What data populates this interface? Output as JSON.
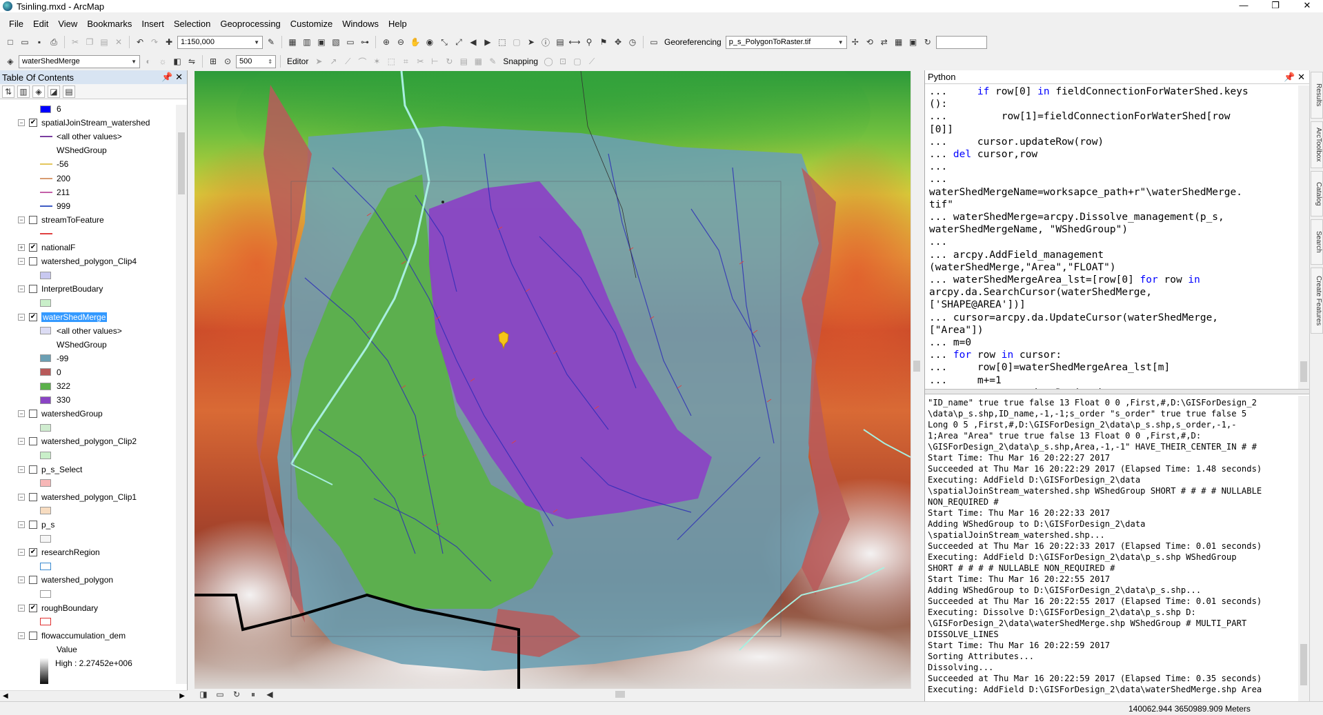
{
  "window": {
    "title": "Tsinling.mxd - ArcMap",
    "min_glyph": "—",
    "max_glyph": "❐",
    "close_glyph": "✕"
  },
  "menu": [
    "File",
    "Edit",
    "View",
    "Bookmarks",
    "Insert",
    "Selection",
    "Geoprocessing",
    "Customize",
    "Windows",
    "Help"
  ],
  "toolbar": {
    "scale": "1:150,000",
    "georeferencing_label": "Georeferencing",
    "georef_layer": "p_s_PolygonToRaster.tif",
    "find_input": "",
    "layer_combo": "waterShedMerge",
    "tolerance": "500",
    "editor_label": "Editor",
    "snapping_label": "Snapping"
  },
  "toc": {
    "title": "Table Of Contents",
    "rows": [
      {
        "kind": "class",
        "label": "6",
        "color": "#0000ff"
      },
      {
        "kind": "layer",
        "label": "spatialJoinStream_watershed",
        "checked": true,
        "expanded": true
      },
      {
        "kind": "class-line",
        "label": "<all other values>",
        "color": "#7a3ea0"
      },
      {
        "kind": "heading",
        "label": "WShedGroup"
      },
      {
        "kind": "class-line",
        "label": "-56",
        "color": "#e3c65c"
      },
      {
        "kind": "class-line",
        "label": "200",
        "color": "#d89b70"
      },
      {
        "kind": "class-line",
        "label": "211",
        "color": "#c45fa8"
      },
      {
        "kind": "class-line",
        "label": "999",
        "color": "#3f5cc4"
      },
      {
        "kind": "layer",
        "label": "streamToFeature",
        "checked": false,
        "expanded": true
      },
      {
        "kind": "class-line",
        "label": "",
        "color": "#e04040"
      },
      {
        "kind": "layer",
        "label": "nationalF",
        "checked": true,
        "expanded": false
      },
      {
        "kind": "layer",
        "label": "watershed_polygon_Clip4",
        "checked": false,
        "expanded": true
      },
      {
        "kind": "class",
        "label": "",
        "color": "#c8c8f0"
      },
      {
        "kind": "layer",
        "label": "InterpretBoudary",
        "checked": false,
        "expanded": true
      },
      {
        "kind": "class",
        "label": "",
        "color": "#c9efc9"
      },
      {
        "kind": "layer",
        "label": "waterShedMerge",
        "checked": true,
        "expanded": true,
        "selected": true
      },
      {
        "kind": "class",
        "label": "<all other values>",
        "color": "#dcdcf4"
      },
      {
        "kind": "heading",
        "label": "WShedGroup"
      },
      {
        "kind": "class",
        "label": "-99",
        "color": "#6b9fb3"
      },
      {
        "kind": "class",
        "label": "0",
        "color": "#b85a5a"
      },
      {
        "kind": "class",
        "label": "322",
        "color": "#5bb04a"
      },
      {
        "kind": "class",
        "label": "330",
        "color": "#8a44c4"
      },
      {
        "kind": "layer",
        "label": "watershedGroup",
        "checked": false,
        "expanded": true
      },
      {
        "kind": "class",
        "label": "",
        "color": "#cfeccf"
      },
      {
        "kind": "layer",
        "label": "watershed_polygon_Clip2",
        "checked": false,
        "expanded": true
      },
      {
        "kind": "class",
        "label": "",
        "color": "#c9efc9"
      },
      {
        "kind": "layer",
        "label": "p_s_Select",
        "checked": false,
        "expanded": true
      },
      {
        "kind": "class",
        "label": "",
        "color": "#f7b7b7"
      },
      {
        "kind": "layer",
        "label": "watershed_polygon_Clip1",
        "checked": false,
        "expanded": true
      },
      {
        "kind": "class",
        "label": "",
        "color": "#f7dcc0"
      },
      {
        "kind": "layer",
        "label": "p_s",
        "checked": false,
        "expanded": true
      },
      {
        "kind": "class",
        "label": "",
        "color": "#f6f6f6"
      },
      {
        "kind": "layer",
        "label": "researchRegion",
        "checked": true,
        "expanded": true
      },
      {
        "kind": "class",
        "label": "",
        "color": "#ffffff",
        "border": "#3a8ad0"
      },
      {
        "kind": "layer",
        "label": "watershed_polygon",
        "checked": false,
        "expanded": true
      },
      {
        "kind": "class",
        "label": "",
        "color": "#ffffff"
      },
      {
        "kind": "layer",
        "label": "roughBoundary",
        "checked": true,
        "expanded": true
      },
      {
        "kind": "class",
        "label": "",
        "color": "#ffffff",
        "border": "#e03030"
      },
      {
        "kind": "layer",
        "label": "flowaccumulation_dem",
        "checked": false,
        "expanded": true
      },
      {
        "kind": "heading",
        "label": "Value"
      },
      {
        "kind": "ramp",
        "label": "High : 2.27452e+006"
      }
    ]
  },
  "python": {
    "title": "Python",
    "code_lines": [
      [
        {
          "t": "...     "
        },
        {
          "t": "if",
          "kw": true
        },
        {
          "t": " row[0] "
        },
        {
          "t": "in",
          "kw": true
        },
        {
          "t": " fieldConnectionForWaterShed.keys"
        }
      ],
      [
        {
          "t": "():"
        }
      ],
      [
        {
          "t": "...         row[1]=fieldConnectionForWaterShed[row"
        }
      ],
      [
        {
          "t": "[0]]"
        }
      ],
      [
        {
          "t": "...     cursor.updateRow(row)"
        }
      ],
      [
        {
          "t": "... "
        },
        {
          "t": "del",
          "kw": true
        },
        {
          "t": " cursor,row"
        }
      ],
      [
        {
          "t": "..."
        }
      ],
      [
        {
          "t": "..."
        }
      ],
      [
        {
          "t": "waterShedMergeName=worksapce_path+r\"\\waterShedMerge."
        }
      ],
      [
        {
          "t": "tif\""
        }
      ],
      [
        {
          "t": "... waterShedMerge=arcpy.Dissolve_management(p_s,"
        }
      ],
      [
        {
          "t": "waterShedMergeName, \"WShedGroup\")"
        }
      ],
      [
        {
          "t": "..."
        }
      ],
      [
        {
          "t": "... arcpy.AddField_management"
        }
      ],
      [
        {
          "t": "(waterShedMerge,\"Area\",\"FLOAT\")"
        }
      ],
      [
        {
          "t": "... waterShedMergeArea_lst=[row[0] "
        },
        {
          "t": "for",
          "kw": true
        },
        {
          "t": " row "
        },
        {
          "t": "in",
          "kw": true
        }
      ],
      [
        {
          "t": "arcpy.da.SearchCursor(waterShedMerge,"
        }
      ],
      [
        {
          "t": "['SHAPE@AREA'])]"
        }
      ],
      [
        {
          "t": "... cursor=arcpy.da.UpdateCursor(waterShedMerge,"
        }
      ],
      [
        {
          "t": "[\"Area\"])"
        }
      ],
      [
        {
          "t": "... m=0"
        }
      ],
      [
        {
          "t": "... "
        },
        {
          "t": "for",
          "kw": true
        },
        {
          "t": " row "
        },
        {
          "t": "in",
          "kw": true
        },
        {
          "t": " cursor:"
        }
      ],
      [
        {
          "t": "...     row[0]=waterShedMergeArea_lst[m]"
        }
      ],
      [
        {
          "t": "...     m+=1"
        }
      ],
      [
        {
          "t": "...     cursor.updateRow(row)"
        }
      ]
    ],
    "output_lines": [
      "\"ID_name\" true true false 13 Float 0 0 ,First,#,D:\\GISForDesign_2",
      "\\data\\p_s.shp,ID_name,-1,-1;s_order \"s_order\" true true false 5",
      "Long 0 5 ,First,#,D:\\GISForDesign_2\\data\\p_s.shp,s_order,-1,-",
      "1;Area \"Area\" true true false 13 Float 0 0 ,First,#,D:",
      "\\GISForDesign_2\\data\\p_s.shp,Area,-1,-1\" HAVE_THEIR_CENTER_IN # #",
      "Start Time: Thu Mar 16 20:22:27 2017",
      "Succeeded at Thu Mar 16 20:22:29 2017 (Elapsed Time: 1.48 seconds)",
      "Executing: AddField D:\\GISForDesign_2\\data",
      "\\spatialJoinStream_watershed.shp WShedGroup SHORT # # # # NULLABLE",
      "NON_REQUIRED #",
      "Start Time: Thu Mar 16 20:22:33 2017",
      "Adding WShedGroup to D:\\GISForDesign_2\\data",
      "\\spatialJoinStream_watershed.shp...",
      "Succeeded at Thu Mar 16 20:22:33 2017 (Elapsed Time: 0.01 seconds)",
      "Executing: AddField D:\\GISForDesign_2\\data\\p_s.shp WShedGroup",
      "SHORT # # # # NULLABLE NON_REQUIRED #",
      "Start Time: Thu Mar 16 20:22:55 2017",
      "Adding WShedGroup to D:\\GISForDesign_2\\data\\p_s.shp...",
      "Succeeded at Thu Mar 16 20:22:55 2017 (Elapsed Time: 0.01 seconds)",
      "Executing: Dissolve D:\\GISForDesign_2\\data\\p_s.shp D:",
      "\\GISForDesign_2\\data\\waterShedMerge.shp WShedGroup # MULTI_PART",
      "DISSOLVE_LINES",
      "Start Time: Thu Mar 16 20:22:59 2017",
      "Sorting Attributes...",
      "Dissolving...",
      "Succeeded at Thu Mar 16 20:22:59 2017 (Elapsed Time: 0.35 seconds)",
      "Executing: AddField D:\\GISForDesign_2\\data\\waterShedMerge.shp Area"
    ]
  },
  "dock_tabs": [
    "Results",
    "ArcToolbox",
    "Catalog",
    "Search",
    "Create Features"
  ],
  "status": {
    "coordinates": "140062.944  3650989.909 Meters"
  },
  "colors": {
    "watershed_330": "#8a44c4",
    "watershed_322": "#5bb04a",
    "watershed_-99": "#6b9fb3",
    "watershed_0": "#b85a5a",
    "selection_highlight": "#3399ff",
    "python_keyword": "#0000ff"
  }
}
